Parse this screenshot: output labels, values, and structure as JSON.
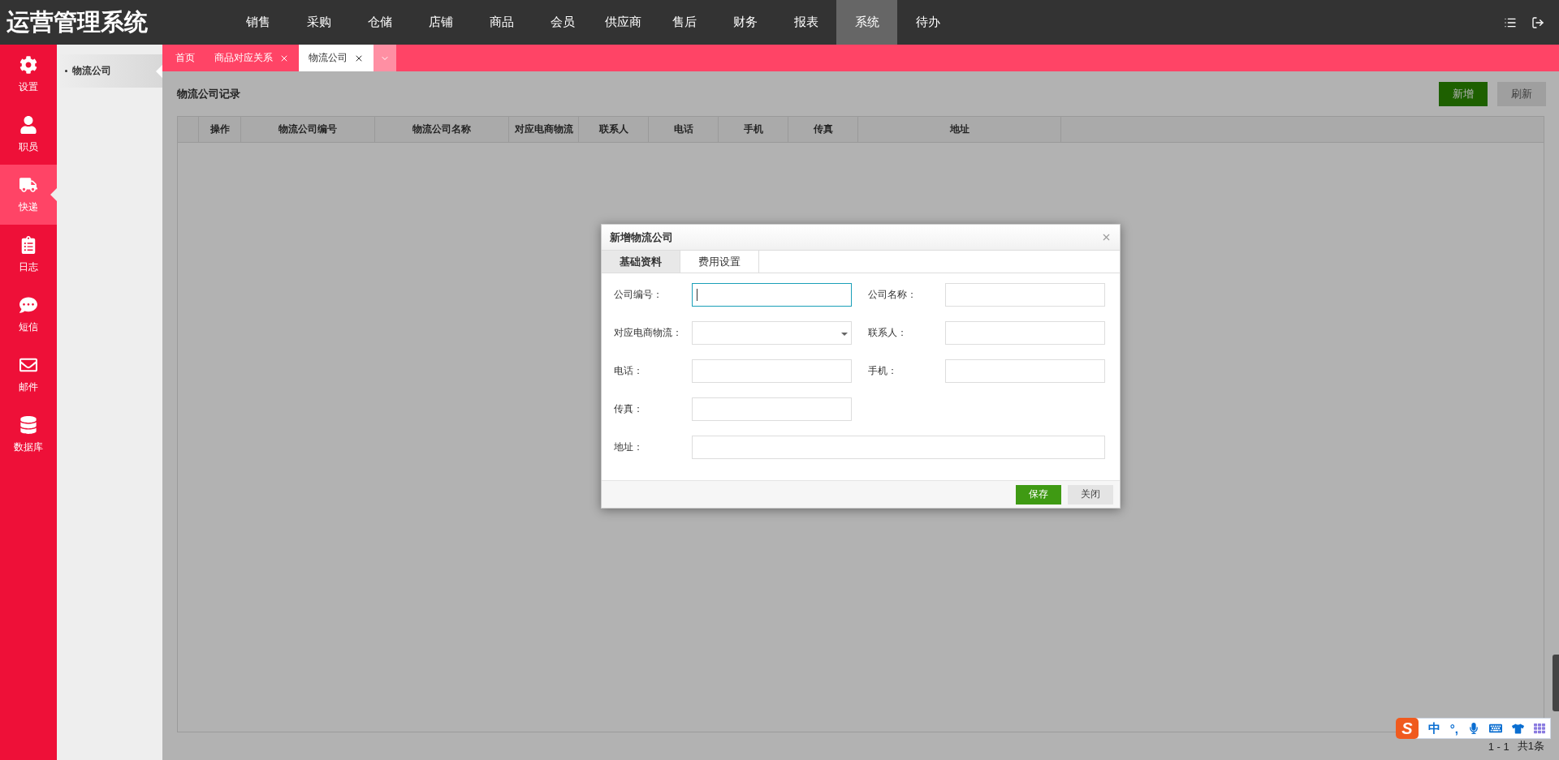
{
  "app_title": "运营管理系统",
  "top_nav": [
    {
      "label": "销售",
      "selected": false
    },
    {
      "label": "采购",
      "selected": false
    },
    {
      "label": "仓储",
      "selected": false
    },
    {
      "label": "店铺",
      "selected": false
    },
    {
      "label": "商品",
      "selected": false
    },
    {
      "label": "会员",
      "selected": false
    },
    {
      "label": "供应商",
      "selected": false
    },
    {
      "label": "售后",
      "selected": false
    },
    {
      "label": "财务",
      "selected": false
    },
    {
      "label": "报表",
      "selected": false
    },
    {
      "label": "系统",
      "selected": true
    },
    {
      "label": "待办",
      "selected": false
    }
  ],
  "side_nav": [
    {
      "label": "设置",
      "selected": false
    },
    {
      "label": "职员",
      "selected": false
    },
    {
      "label": "快递",
      "selected": true
    },
    {
      "label": "日志",
      "selected": false
    },
    {
      "label": "短信",
      "selected": false
    },
    {
      "label": "邮件",
      "selected": false
    },
    {
      "label": "数据库",
      "selected": false
    }
  ],
  "sub_menu": [
    {
      "label": "物流公司",
      "selected": true
    }
  ],
  "tabs": [
    {
      "label": "首页",
      "closable": false,
      "selected": false
    },
    {
      "label": "商品对应关系",
      "closable": true,
      "selected": false
    },
    {
      "label": "物流公司",
      "closable": true,
      "selected": true
    }
  ],
  "page": {
    "title": "物流公司记录",
    "buttons": [
      {
        "label": "新增",
        "kind": "primary"
      },
      {
        "label": "刷新",
        "kind": "default"
      }
    ],
    "columns": [
      "操作",
      "物流公司编号",
      "物流公司名称",
      "对应电商物流",
      "联系人",
      "电话",
      "手机",
      "传真",
      "地址"
    ],
    "pager": {
      "range": "1 - 1",
      "total": "共1条"
    }
  },
  "dialog": {
    "title": "新增物流公司",
    "tabs": [
      {
        "label": "基础资料",
        "selected": true
      },
      {
        "label": "费用设置",
        "selected": false
      }
    ],
    "fields": [
      {
        "label": "公司编号：",
        "kind": "text",
        "focused": true
      },
      {
        "label": "公司名称：",
        "kind": "text",
        "focused": false
      },
      {
        "label": "对应电商物流：",
        "kind": "select",
        "focused": false
      },
      {
        "label": "联系人：",
        "kind": "text",
        "focused": false
      },
      {
        "label": "电话：",
        "kind": "text",
        "focused": false
      },
      {
        "label": "手机：",
        "kind": "text",
        "focused": false
      },
      {
        "label": "传真：",
        "kind": "text",
        "focused": false
      },
      {
        "label": "地址：",
        "kind": "wide",
        "focused": false
      }
    ],
    "buttons": [
      {
        "label": "保存",
        "kind": "primary"
      },
      {
        "label": "关闭",
        "kind": "default"
      }
    ]
  },
  "ime": {
    "logo": "S",
    "items": [
      "中",
      "°,"
    ]
  }
}
